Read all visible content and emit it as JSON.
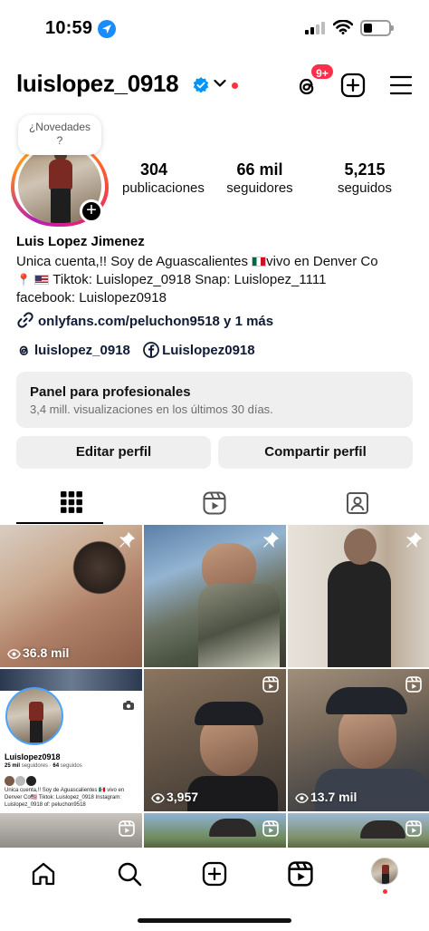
{
  "status_bar": {
    "time": "10:59"
  },
  "header": {
    "username": "luislopez_0918",
    "notification_badge": "9+"
  },
  "profile": {
    "story_bubble": "¿Novedades\n?",
    "stats": [
      {
        "value": "304",
        "label": "publicaciones"
      },
      {
        "value": "66 mil",
        "label": "seguidores"
      },
      {
        "value": "5,215",
        "label": "seguidos"
      }
    ],
    "full_name": "Luis Lopez Jimenez",
    "bio_line1_a": "Unica cuenta,!! Soy de Aguascalientes ",
    "bio_line1_b": "vivo en Denver Co",
    "bio_line2": " Tiktok: Luislopez_0918 Snap: Luislopez_1111",
    "bio_line3": "facebook: Luislopez0918",
    "link": "onlyfans.com/peluchon9518 y 1 más",
    "threads_handle": "luislopez_0918",
    "facebook_handle": "Luislopez0918"
  },
  "panel": {
    "title": "Panel para profesionales",
    "subtitle": "3,4 mill. visualizaciones en los últimos 30 días."
  },
  "buttons": {
    "edit": "Editar perfil",
    "share": "Compartir perfil"
  },
  "grid": {
    "views": [
      "36.8 mil",
      "3,957",
      "13.7 mil"
    ]
  },
  "mini_profile": {
    "name": "Luislopez0918",
    "followers": "25 mil",
    "followers_label": "seguidores",
    "following": "64",
    "following_label": "seguidos",
    "bio": "Unica cuenta,!! Soy de Aguascalientes 🇲🇽 vivo en Denver Co🇺🇸 Tiktok: Luislopez_0918 Instagram: Luislopez_0918 of: peluchon9518"
  },
  "colors": {
    "accent_blue": "#0095f6",
    "badge_red": "#ff2f4b",
    "panel_bg": "#efefef"
  }
}
